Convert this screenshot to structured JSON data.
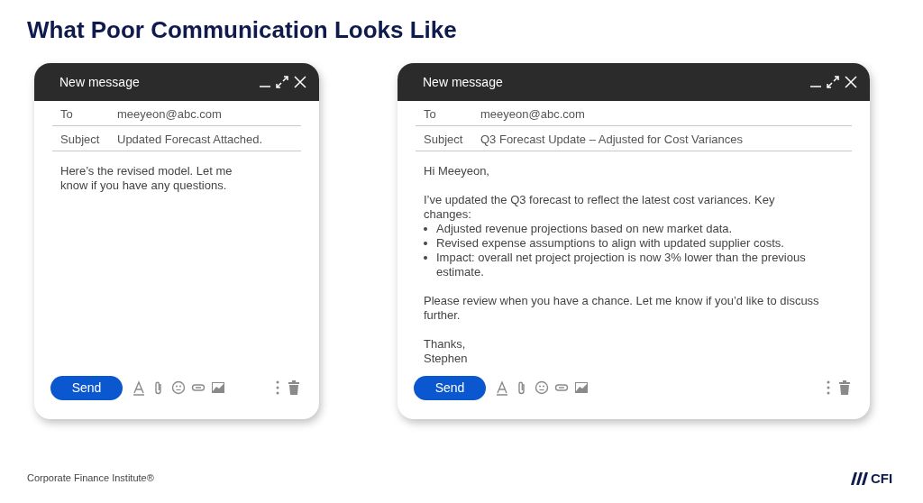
{
  "title": "What Poor Communication Looks Like",
  "emails": [
    {
      "window_title": "New message",
      "to_label": "To",
      "to": "meeyeon@abc.com",
      "subject_label": "Subject",
      "subject": "Updated Forecast Attached.",
      "body": [
        {
          "kind": "text",
          "text": "Here’s the revised model. Let me know if you have any questions."
        }
      ],
      "send": "Send"
    },
    {
      "window_title": "New message",
      "to_label": "To",
      "to": "meeyeon@abc.com",
      "subject_label": "Subject",
      "subject": "Q3 Forecast Update – Adjusted for Cost Variances",
      "body": [
        {
          "kind": "text",
          "text": "Hi Meeyeon,"
        },
        {
          "kind": "text",
          "text": "I’ve updated the Q3 forecast to reflect the latest cost variances. Key changes:"
        },
        {
          "kind": "bullets",
          "items": [
            "Adjusted revenue projections based on new market data.",
            "Revised expense assumptions to align with updated supplier costs.",
            "Impact: overall net project projection is now 3% lower than the previous estimate."
          ]
        },
        {
          "kind": "text",
          "text": "Please review when you have a chance. Let me know if you’d like to discuss further."
        },
        {
          "kind": "lines",
          "items": [
            "Thanks,",
            "Stephen"
          ]
        }
      ],
      "send": "Send"
    }
  ],
  "footer": {
    "text": "Corporate Finance Institute®",
    "logo": "CFI"
  }
}
